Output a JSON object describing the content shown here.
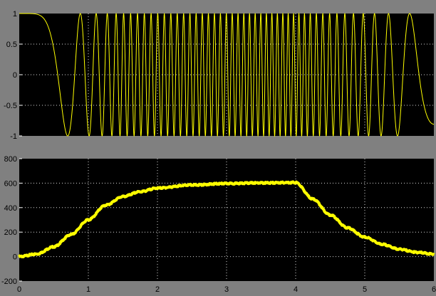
{
  "window": {
    "background": "#808080",
    "axes_background": "#000000",
    "grid_color": "#ffffff",
    "trace_color": "#ffff00",
    "tick_label_color": "#000000"
  },
  "chart_data": [
    {
      "type": "line",
      "title": "",
      "xlabel": "",
      "ylabel": "",
      "xlim": [
        0,
        6
      ],
      "ylim": [
        -1,
        1
      ],
      "grid": true,
      "legend": "none",
      "x_ticks": [],
      "y_ticks": [
        1,
        0.5,
        0,
        -0.5,
        -1
      ],
      "y_tick_labels": [
        "1",
        "0.5",
        "0",
        "-0.5",
        "-1"
      ],
      "series": [
        {
          "color": "#ffff00",
          "description_of_values": "cos(theta) with frequency ramping up from 0 to ~13 Hz by t=4 then decelerating back to 0 at t=6",
          "frequency_profile_x": [
            0,
            1.5,
            4,
            6
          ],
          "frequency_profile_hz": [
            0,
            9.8,
            13,
            0
          ],
          "x_sample": [
            0,
            0.6,
            0.9,
            1.5,
            2,
            3,
            4,
            4.8,
            5.2,
            6
          ],
          "y_sample": [
            1,
            -1,
            1,
            -1,
            1,
            -1,
            1,
            -1,
            1,
            -1
          ]
        }
      ]
    },
    {
      "type": "line",
      "title": "",
      "xlabel": "",
      "ylabel": "",
      "xlim": [
        0,
        6
      ],
      "ylim": [
        -200,
        800
      ],
      "grid": true,
      "legend": "none",
      "x_ticks": [
        0,
        1,
        2,
        3,
        4,
        5,
        6
      ],
      "x_tick_labels": [
        "0",
        "1",
        "2",
        "3",
        "4",
        "5",
        "6"
      ],
      "y_ticks": [
        800,
        600,
        400,
        200,
        0,
        -200
      ],
      "y_tick_labels": [
        "800",
        "600",
        "400",
        "200",
        "0",
        "-200"
      ],
      "series": [
        {
          "color": "#ffff00",
          "x": [
            0,
            0.25,
            0.5,
            0.75,
            1.0,
            1.25,
            1.5,
            1.75,
            2.0,
            2.5,
            3.0,
            3.5,
            4.0,
            4.25,
            4.5,
            4.75,
            5.0,
            5.25,
            5.5,
            5.75,
            6.0
          ],
          "y": [
            0,
            20,
            80,
            180,
            300,
            420,
            490,
            530,
            560,
            585,
            597,
            602,
            605,
            470,
            340,
            235,
            160,
            100,
            60,
            35,
            20
          ]
        }
      ]
    }
  ]
}
